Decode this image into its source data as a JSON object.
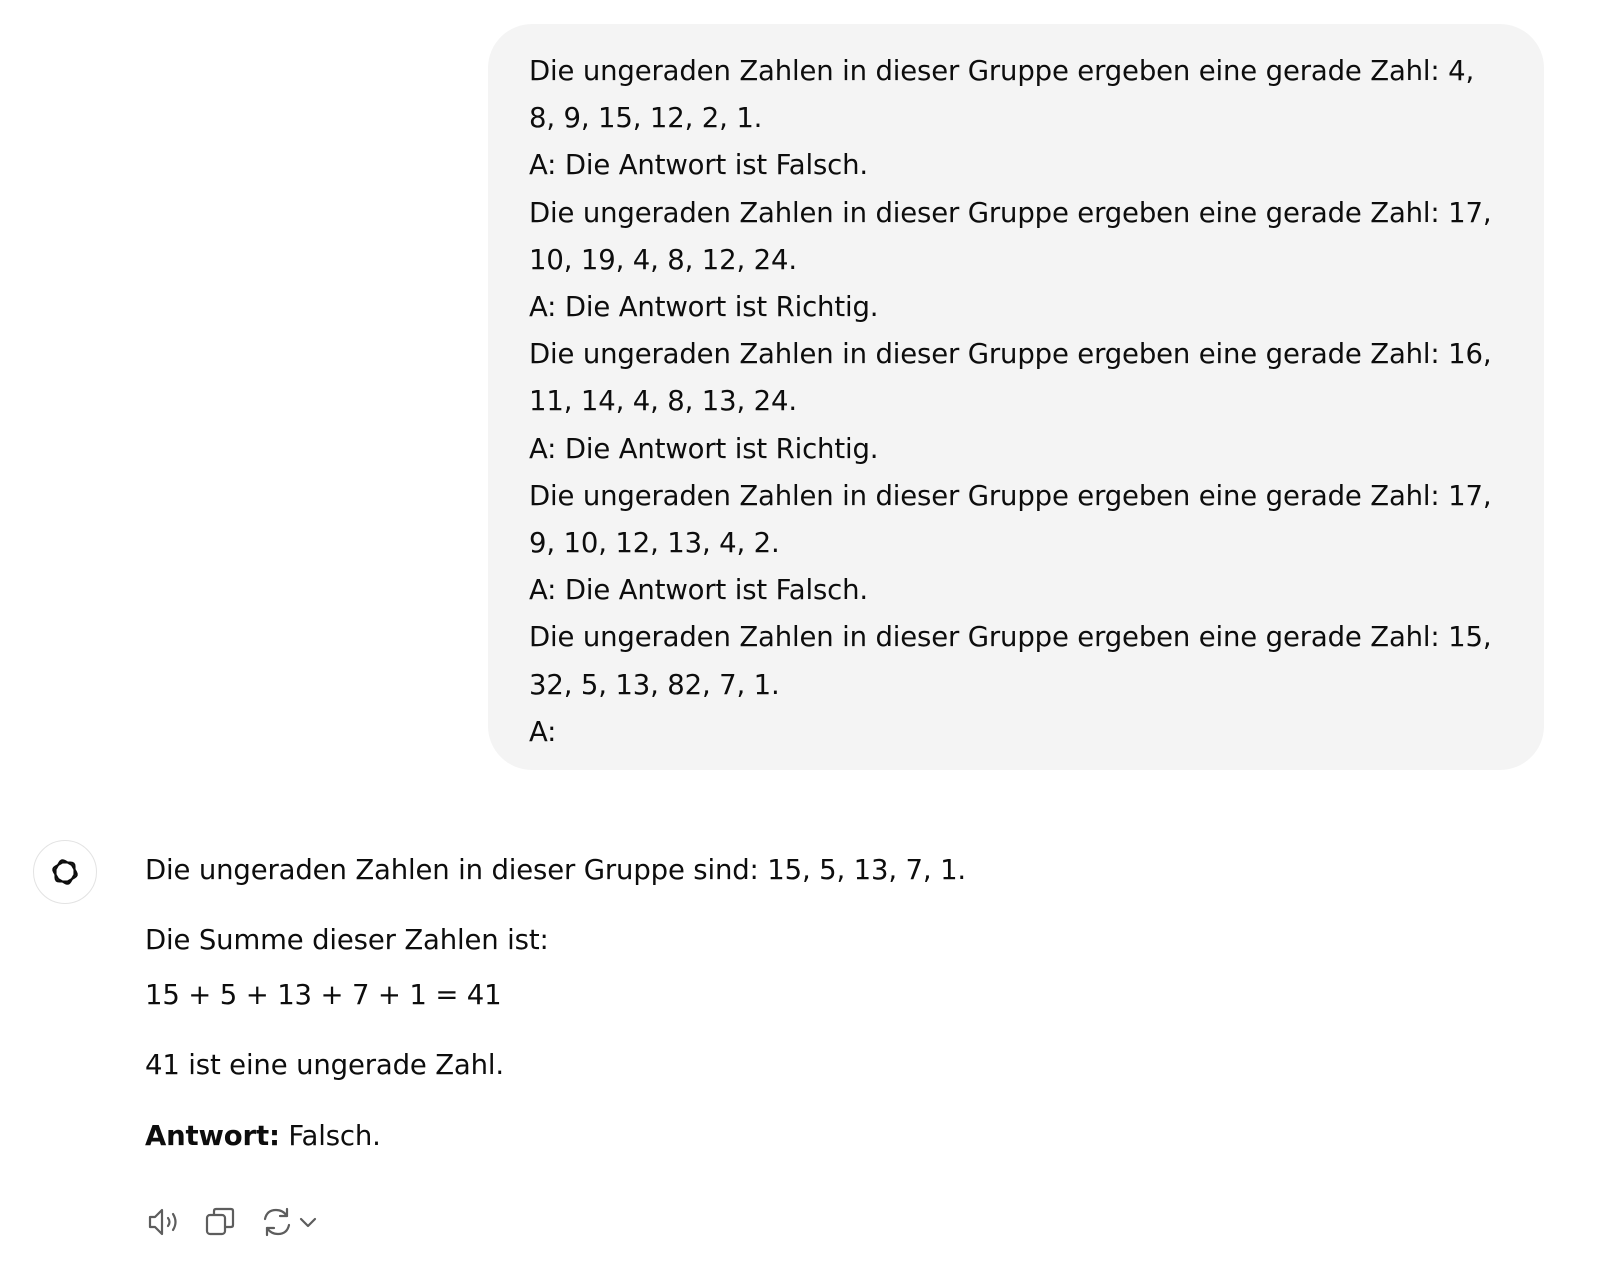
{
  "user_message": {
    "lines": [
      "Die ungeraden Zahlen in dieser Gruppe ergeben eine gerade Zahl: 4,",
      "8, 9, 15, 12, 2, 1.",
      "A: Die Antwort ist Falsch.",
      "Die ungeraden Zahlen in dieser Gruppe ergeben eine gerade Zahl: 17,",
      "10, 19, 4, 8, 12, 24.",
      "A: Die Antwort ist Richtig.",
      "Die ungeraden Zahlen in dieser Gruppe ergeben eine gerade Zahl: 16,",
      "11, 14, 4, 8, 13, 24.",
      "A: Die Antwort ist Richtig.",
      "Die ungeraden Zahlen in dieser Gruppe ergeben eine gerade Zahl: 17,",
      "9, 10, 12, 13, 4, 2.",
      "A: Die Antwort ist Falsch.",
      "Die ungeraden Zahlen in dieser Gruppe ergeben eine gerade Zahl: 15,",
      "32, 5, 13, 82, 7, 1.",
      "A:"
    ]
  },
  "assistant_message": {
    "avatar_icon": "openai-logo-icon",
    "paragraph_1": "Die ungeraden Zahlen in dieser Gruppe sind: 15, 5, 13, 7, 1.",
    "paragraph_2": "Die Summe dieser Zahlen ist:",
    "paragraph_3": "15 + 5 + 13 + 7 + 1 = 41",
    "paragraph_4": "41 ist eine ungerade Zahl.",
    "answer_label": "Antwort:",
    "answer_value": " Falsch."
  },
  "actions": {
    "read_aloud_icon": "speaker-icon",
    "copy_icon": "copy-icon",
    "regenerate_icon": "refresh-icon",
    "model_menu_icon": "chevron-down-icon"
  }
}
